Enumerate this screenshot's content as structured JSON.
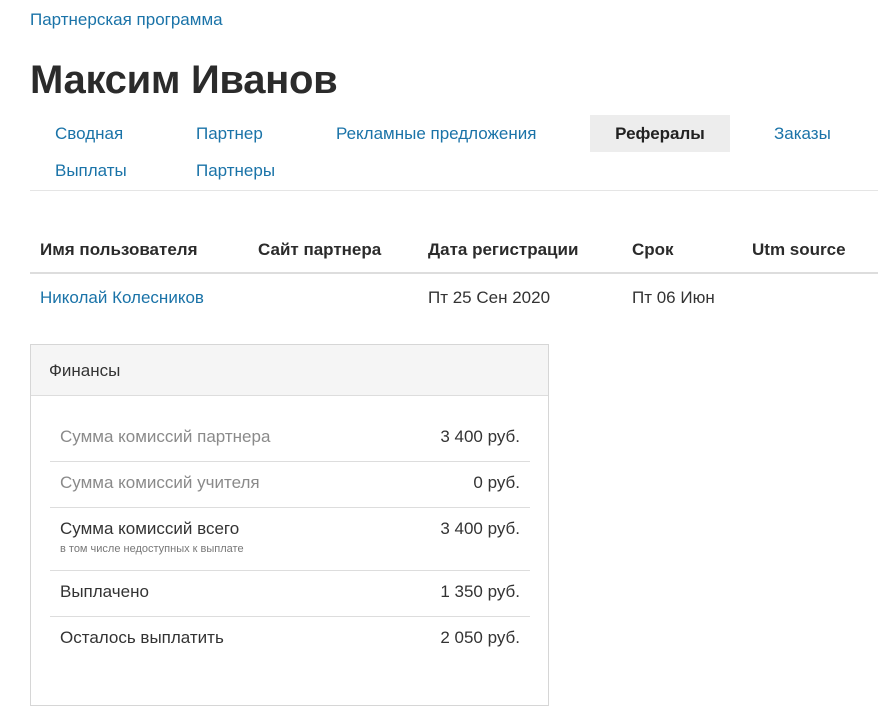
{
  "breadcrumb": "Партнерская программа",
  "page_title": "Максим Иванов",
  "tabs": [
    {
      "label": "Сводная",
      "active": false
    },
    {
      "label": "Партнер",
      "active": false
    },
    {
      "label": "Рекламные предложения",
      "active": false
    },
    {
      "label": "Рефералы",
      "active": true
    },
    {
      "label": "Заказы",
      "active": false
    },
    {
      "label": "Выплаты",
      "active": false
    },
    {
      "label": "Партнеры",
      "active": false
    }
  ],
  "referrals": {
    "columns": [
      "Имя пользователя",
      "Сайт партнера",
      "Дата регистрации",
      "Срок",
      "Utm source"
    ],
    "rows": [
      {
        "user": "Николай Колесников",
        "site": "",
        "registered": "Пт 25 Сен 2020",
        "term": "Пт 06 Июн",
        "utm": ""
      }
    ]
  },
  "finance": {
    "title": "Финансы",
    "rows": [
      {
        "label": "Сумма комиссий партнера",
        "value": "3 400 руб.",
        "note": ""
      },
      {
        "label": "Сумма комиссий учителя",
        "value": "0 руб.",
        "note": ""
      },
      {
        "label": "Сумма комиссий всего",
        "value": "3 400 руб.",
        "note": "в том числе недоступных к выплате"
      },
      {
        "label": "Выплачено",
        "value": "1 350 руб.",
        "note": ""
      },
      {
        "label": "Осталось выплатить",
        "value": "2 050 руб.",
        "note": ""
      }
    ]
  },
  "colors": {
    "link": "#1a73a8",
    "active_tab_bg": "#ededed",
    "panel_header_bg": "#f5f5f5"
  }
}
